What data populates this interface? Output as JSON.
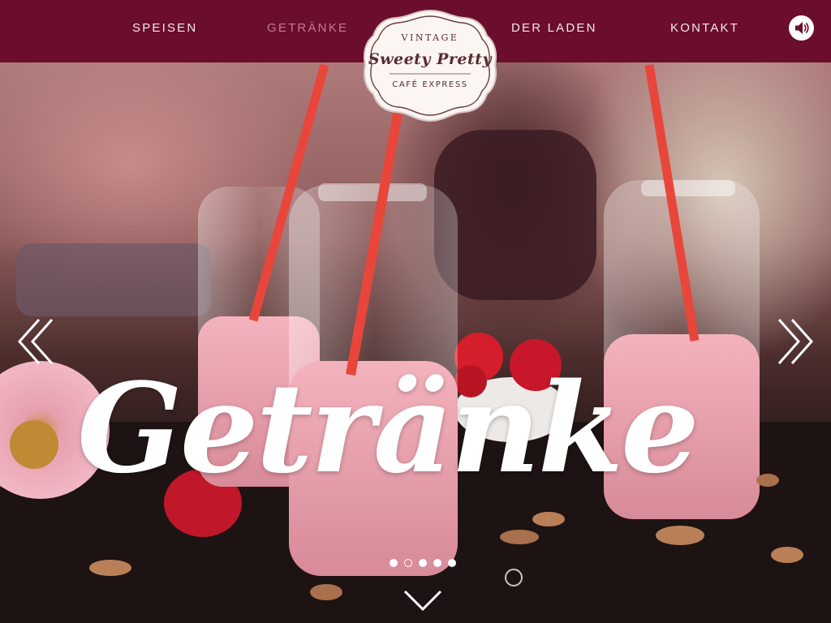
{
  "nav": {
    "items": [
      {
        "label": "SPEISEN",
        "active": false
      },
      {
        "label": "GETRÄNKE",
        "active": true
      },
      {
        "label": "DER LADEN",
        "active": false
      },
      {
        "label": "KONTAKT",
        "active": false
      }
    ],
    "sound_icon": "speaker-icon"
  },
  "logo": {
    "top": "VINTAGE",
    "main": "Sweety Pretty",
    "bottom": "CAFÉ EXPRESS"
  },
  "hero": {
    "headline": "Getränke",
    "prev_icon": "double-chevron-left-icon",
    "next_icon": "double-chevron-right-icon",
    "down_icon": "chevron-down-icon"
  },
  "slider": {
    "slide_count": 5,
    "active_index": 1
  },
  "colors": {
    "brand_bar": "#6b0d2c",
    "nav_text": "#f3e8ec",
    "nav_active": "#c47a92",
    "headline": "#ffffff"
  }
}
